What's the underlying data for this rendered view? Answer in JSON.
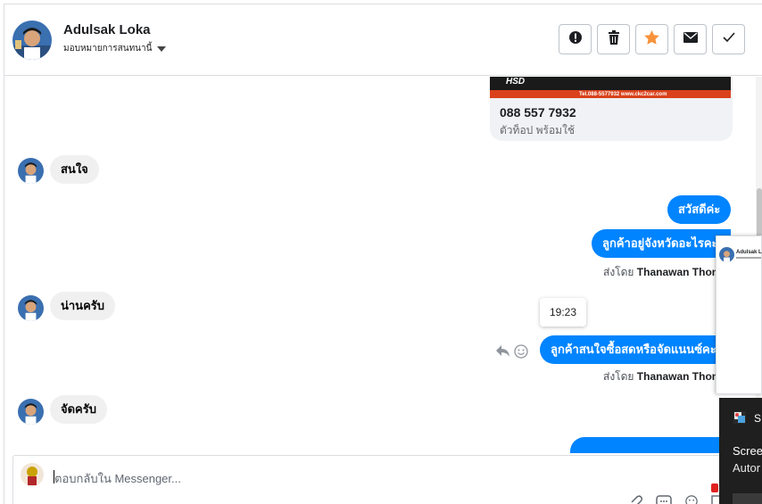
{
  "header": {
    "name": "Adulsak Loka",
    "subtitle": "มอบหมายการสนทนานี้",
    "actions": [
      "spam-icon",
      "trash-icon",
      "star-icon",
      "envelope-icon",
      "check-icon"
    ]
  },
  "card": {
    "banner_left": "HSD",
    "banner_right": "Tel.088-5577932     www.ckc2car.com",
    "phone": "088 557 7932",
    "description": "ตัวท็อป พร้อมใช้"
  },
  "messages": {
    "in1": "สนใจ",
    "out1": "สวัสดีค่ะ",
    "out2": "ลูกค้าอยู่จังหวัดอะไรคะ",
    "sentby1_prefix": "ส่งโดย",
    "sentby1_name": "Thanawan Thon",
    "in2": "น่านครับ",
    "time": "19:23",
    "out3": "ลูกค้าสนใจซื้อสดหรือจัดแนนซ์คะ",
    "sentby2_prefix": "ส่งโดย",
    "sentby2_name": "Thanawan Thon",
    "in3": "จัดครับ"
  },
  "composer": {
    "placeholder": "ตอบกลับใน Messenger..."
  },
  "popup": {
    "name": "Adulsak L"
  },
  "notification": {
    "title": "S",
    "line1": "Scree",
    "line2": "Autor"
  },
  "colors": {
    "accent": "#0084ff",
    "star": "#f7923a",
    "bubble_in": "#f0f0f0"
  }
}
